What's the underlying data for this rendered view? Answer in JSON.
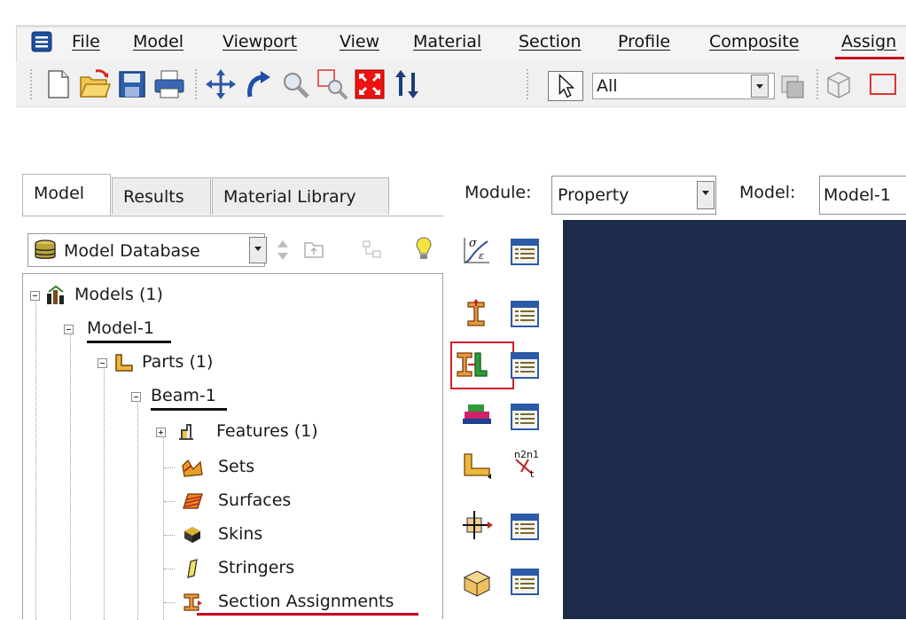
{
  "menu": {
    "items": [
      "File",
      "Model",
      "Viewport",
      "View",
      "Material",
      "Section",
      "Profile",
      "Composite",
      "Assign"
    ]
  },
  "toolbar": {
    "selection_filter": "All"
  },
  "tabs": [
    "Model",
    "Results",
    "Material Library"
  ],
  "database": {
    "selected": "Model Database"
  },
  "module_bar": {
    "module_label": "Module:",
    "module_value": "Property",
    "model_label": "Model:",
    "model_value": "Model-1"
  },
  "tree": {
    "models": "Models (1)",
    "model_1": "Model-1",
    "parts": "Parts (1)",
    "beam_1": "Beam-1",
    "features": "Features (1)",
    "sets": "Sets",
    "surfaces": "Surfaces",
    "skins": "Skins",
    "stringers": "Stringers",
    "section_assignments": "Section Assignments"
  },
  "colors": {
    "viewport_bg": "#1c2b4a",
    "highlight": "#d21e2a",
    "accent_underline": "#c8001e"
  },
  "icons": {
    "toolbar": [
      "new-file-icon",
      "open-icon",
      "save-icon",
      "print-icon",
      "pan-icon",
      "rotate-icon",
      "zoom-icon",
      "box-zoom-icon",
      "auto-fit-icon",
      "cycle-views-icon",
      "select-arrow-icon"
    ],
    "module_tools": [
      "create-material-icon",
      "create-section-icon",
      "assign-section-icon",
      "create-profile-icon",
      "assign-orientation-icon",
      "special-inertia-icon",
      "skin-icon"
    ]
  }
}
